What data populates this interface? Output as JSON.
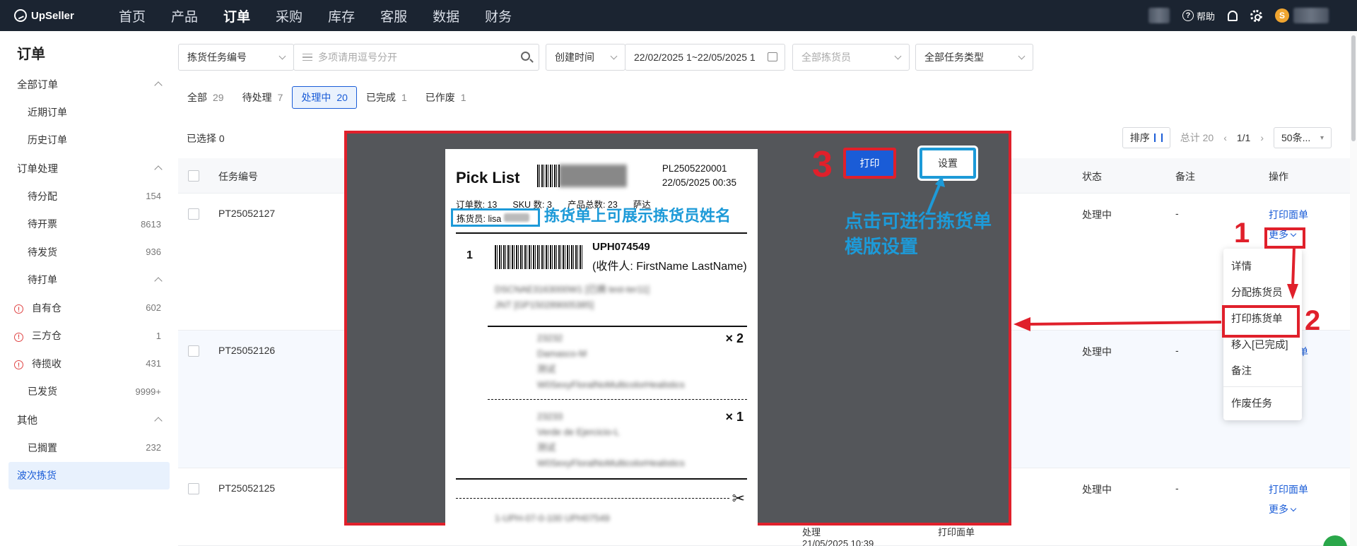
{
  "topbar": {
    "logo": "UpSeller",
    "nav": [
      "首页",
      "产品",
      "订单",
      "采购",
      "库存",
      "客服",
      "数据",
      "财务"
    ],
    "active_nav": "订单",
    "help": "帮助",
    "coin": "S"
  },
  "sidebar": {
    "title": "订单",
    "groups": [
      {
        "label": "全部订单",
        "items": [
          {
            "label": "近期订单",
            "count": ""
          },
          {
            "label": "历史订单",
            "count": ""
          }
        ]
      },
      {
        "label": "订单处理",
        "items": [
          {
            "label": "待分配",
            "count": "154"
          },
          {
            "label": "待开票",
            "count": "8613"
          },
          {
            "label": "待发货",
            "count": "936"
          }
        ]
      },
      {
        "label": "待打单",
        "items": [
          {
            "label": "自有仓",
            "count": "602"
          },
          {
            "label": "三方仓",
            "count": "1"
          },
          {
            "label": "待揽收",
            "count": "431"
          },
          {
            "label": "已发货",
            "count": "9999+"
          }
        ]
      },
      {
        "label": "其他",
        "items": [
          {
            "label": "已搁置",
            "count": "232"
          }
        ]
      }
    ],
    "selected": "波次拣货"
  },
  "filters": {
    "task_no_select": "拣货任务编号",
    "search_placeholder": "多项请用逗号分开",
    "time_select": "创建时间",
    "date_range": "22/02/2025 1~22/05/2025 1",
    "picker_select": "全部拣货员",
    "type_select": "全部任务类型"
  },
  "tabs": [
    {
      "label": "全部",
      "num": "29"
    },
    {
      "label": "待处理",
      "num": "7"
    },
    {
      "label": "处理中",
      "num": "20"
    },
    {
      "label": "已完成",
      "num": "1"
    },
    {
      "label": "已作废",
      "num": "1"
    }
  ],
  "toolbar": {
    "selected": "已选择 0",
    "sort": "排序",
    "total": "总计 20",
    "page": "1/1",
    "page_size": "50条..."
  },
  "table": {
    "headers": {
      "task_no": "任务编号",
      "status": "状态",
      "remark": "备注",
      "actions": "操作"
    },
    "rows": [
      {
        "task_no": "PT25052127",
        "status": "处理中",
        "remark": "-",
        "action": "打印面单",
        "more": "更多"
      },
      {
        "task_no": "PT25052126",
        "status": "处理中",
        "remark": "-",
        "action": "打印面单",
        "more": ""
      },
      {
        "task_no": "PT25052125",
        "status": "处理中",
        "remark": "-",
        "action": "打印面单",
        "more": "更多"
      }
    ],
    "row3_extra": {
      "col_a": "处理",
      "col_a_time": "21/05/2025 10:39",
      "col_b": "打印面单"
    }
  },
  "dropdown": {
    "items": [
      "详情",
      "分配拣货员",
      "打印拣货单",
      "移入[已完成]",
      "备注",
      "作废任务"
    ]
  },
  "preview": {
    "title": "Pick List",
    "pl_no": "PL2505220001",
    "pl_time": "22/05/2025 00:35",
    "stats": {
      "orders": "订单数: 13",
      "sku": "SKU 数: 3",
      "products": "产品总数: 23",
      "shop": "萨达"
    },
    "picker": "拣货员: lisa",
    "order_index": "1",
    "order_no": "UPH074549",
    "recipient": "(收件人: FirstName LastName)",
    "blur_lines": [
      "DSCNAE3163000W1 [已摘 test-ter11]",
      "JNT [GP150289005385]"
    ],
    "item1_lines": [
      "23232",
      "Damasco-M",
      "测试",
      "W0SexyFloralNoMulticolorHealistics"
    ],
    "item2_lines": [
      "23233",
      "Verde de Ejercicio-L",
      "测试",
      "W0SexyFloralNoMulticolorHealistics"
    ],
    "qty1": "× 2",
    "qty2": "× 1",
    "bottom_line": "1-UPH-07-0-100 UPH07549"
  },
  "buttons": {
    "print": "打印",
    "settings": "设置"
  },
  "annotations": {
    "picker_note": "拣货单上可展示拣货员姓名",
    "settings_note_line1": "点击可进行拣货单",
    "settings_note_line2": "模版设置",
    "step1": "1",
    "step2": "2",
    "step3": "3"
  },
  "colors": {
    "accent": "#1a5cd7",
    "annotation_red": "#e0202b",
    "annotation_blue": "#1d9ad8",
    "nav_bg": "#1b2431"
  }
}
